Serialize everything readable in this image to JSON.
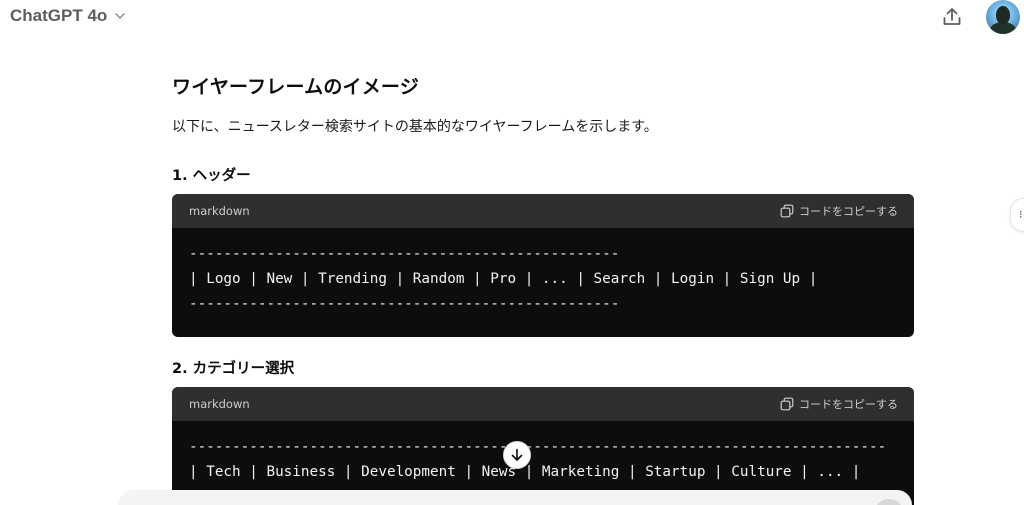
{
  "header": {
    "model_name": "ChatGPT 4o"
  },
  "content": {
    "heading": "ワイヤーフレームのイメージ",
    "intro": "以下に、ニュースレター検索サイトの基本的なワイヤーフレームを示します。",
    "sections": [
      {
        "title": "1. ヘッダー",
        "code": {
          "language": "markdown",
          "copy_label": "コードをコピーする",
          "lines": [
            "--------------------------------------------------",
            "| Logo | New | Trending | Random | Pro | ... | Search | Login | Sign Up |",
            "--------------------------------------------------"
          ]
        }
      },
      {
        "title": "2. カテゴリー選択",
        "code": {
          "language": "markdown",
          "copy_label": "コードをコピーする",
          "lines": [
            "---------------------------------------------------------------------------------",
            "| Tech | Business | Development | News | Marketing | Startup | Culture | ... |"
          ]
        }
      }
    ]
  },
  "icons": {
    "chevron": "chevron-down-icon",
    "share": "share-icon",
    "copy": "copy-icon",
    "scroll": "arrow-down-icon"
  }
}
